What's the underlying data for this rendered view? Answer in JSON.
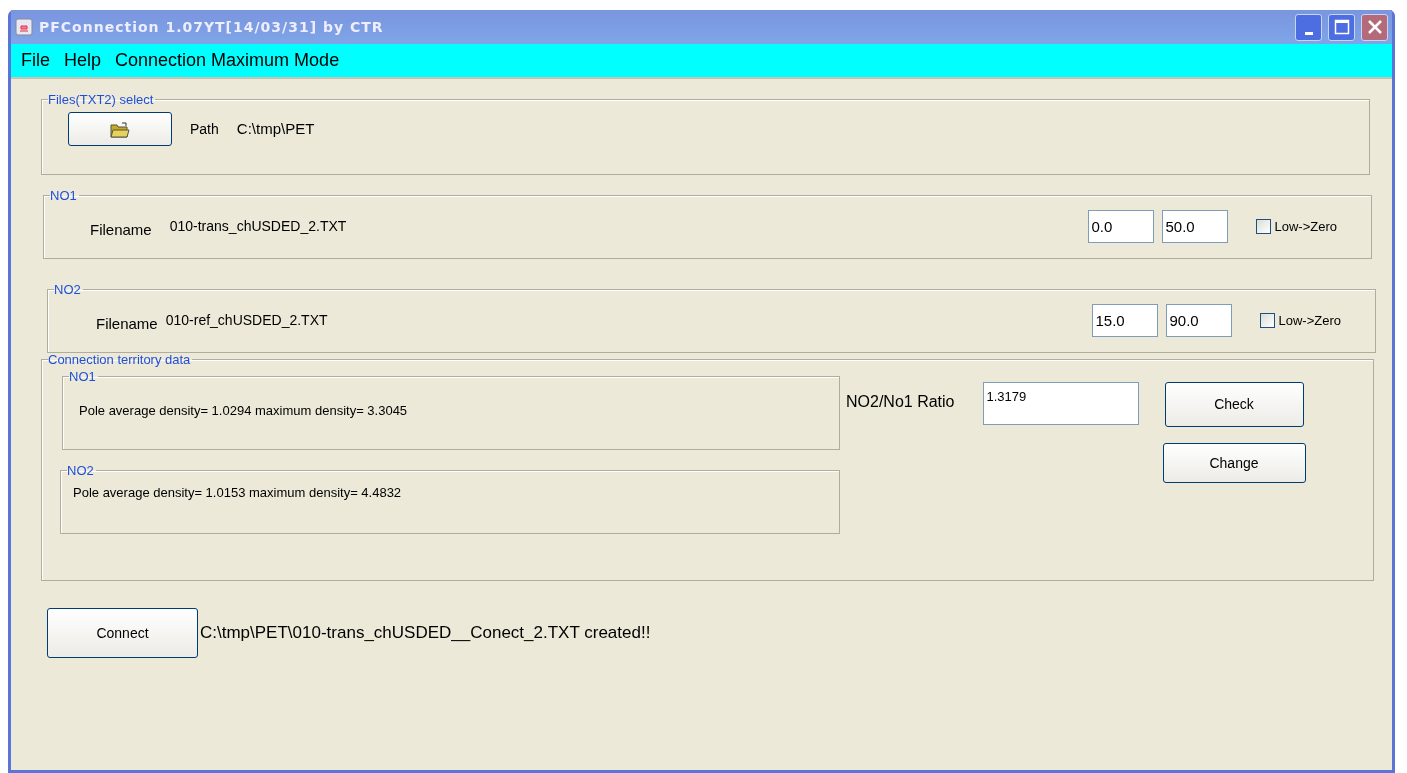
{
  "window": {
    "title": "PFConnection 1.07YT[14/03/31] by CTR"
  },
  "menu": [
    "File",
    "Help",
    "Connection Maximum Mode"
  ],
  "files_select": {
    "legend": "Files(TXT2) select",
    "path_label": "Path",
    "path": "C:\\tmp\\PET"
  },
  "inputs": [
    {
      "legend": "NO1",
      "filename_label": "Filename",
      "filename": "010-trans_chUSDED_2.TXT",
      "low": "0.0",
      "high": "50.0",
      "checkbox": {
        "label": "Low->Zero",
        "checked": false
      }
    },
    {
      "legend": "NO2",
      "filename_label": "Filename",
      "filename": "010-ref_chUSDED_2.TXT",
      "low": "15.0",
      "high": "90.0",
      "checkbox": {
        "label": "Low->Zero",
        "checked": false
      }
    }
  ],
  "territory": {
    "legend": "Connection territory data",
    "groups": [
      {
        "legend": "NO1",
        "text": "Pole average density= 1.0294 maximum density= 3.3045"
      },
      {
        "legend": "NO2",
        "text": "Pole average density= 1.0153 maximum density= 4.4832"
      }
    ],
    "ratio_label": "NO2/No1 Ratio",
    "ratio": "1.3179",
    "buttons": [
      "Check",
      "Change"
    ]
  },
  "connect": {
    "button": "Connect",
    "message": "C:\\tmp\\PET\\010-trans_chUSDED__Conect_2.TXT created!!"
  }
}
